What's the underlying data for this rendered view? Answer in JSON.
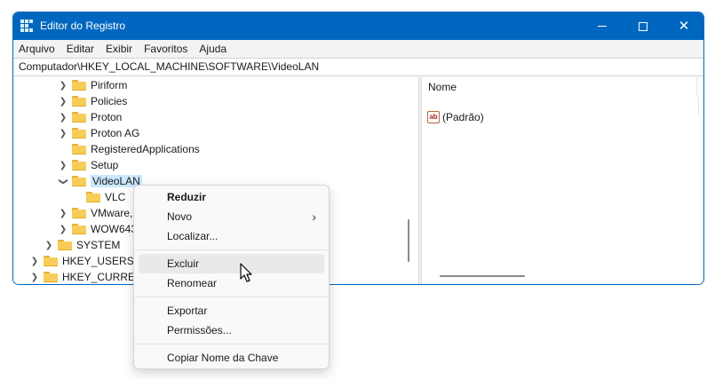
{
  "window": {
    "title": "Editor do Registro",
    "controls": {
      "minimize": "–",
      "maximize": "□",
      "close": "✕"
    },
    "accent_color": "#0067c0"
  },
  "menubar": [
    "Arquivo",
    "Editar",
    "Exibir",
    "Favoritos",
    "Ajuda"
  ],
  "address": "Computador\\HKEY_LOCAL_MACHINE\\SOFTWARE\\VideoLAN",
  "tree": [
    {
      "label": "Piriform",
      "expander": "collapsed",
      "level": 3
    },
    {
      "label": "Policies",
      "expander": "collapsed",
      "level": 3
    },
    {
      "label": "Proton",
      "expander": "collapsed",
      "level": 3
    },
    {
      "label": "Proton AG",
      "expander": "collapsed",
      "level": 3
    },
    {
      "label": "RegisteredApplications",
      "expander": "none",
      "level": 3
    },
    {
      "label": "Setup",
      "expander": "collapsed",
      "level": 3
    },
    {
      "label": "VideoLAN",
      "expander": "expanded",
      "level": 3,
      "selected": true
    },
    {
      "label": "VLC",
      "expander": "none",
      "level": 4
    },
    {
      "label": "VMware,",
      "expander": "collapsed",
      "level": 3
    },
    {
      "label": "WOW643",
      "expander": "collapsed",
      "level": 3
    },
    {
      "label": "SYSTEM",
      "expander": "collapsed",
      "level": 2
    },
    {
      "label": "HKEY_USERS",
      "expander": "collapsed",
      "level": 1
    },
    {
      "label": "HKEY_CURRENT",
      "expander": "collapsed",
      "level": 1
    }
  ],
  "values_pane": {
    "column_name": "Nome",
    "entries": [
      {
        "icon": "string-value-icon",
        "icon_text": "ab",
        "name": "(Padrão)"
      }
    ]
  },
  "context_menu": [
    {
      "label": "Reduzir",
      "bold": true
    },
    {
      "label": "Novo",
      "submenu": true
    },
    {
      "label": "Localizar..."
    },
    {
      "separator": true
    },
    {
      "label": "Excluir",
      "hovered": true
    },
    {
      "label": "Renomear"
    },
    {
      "separator": true
    },
    {
      "label": "Exportar"
    },
    {
      "label": "Permissões..."
    },
    {
      "separator": true
    },
    {
      "label": "Copiar Nome da Chave"
    }
  ]
}
